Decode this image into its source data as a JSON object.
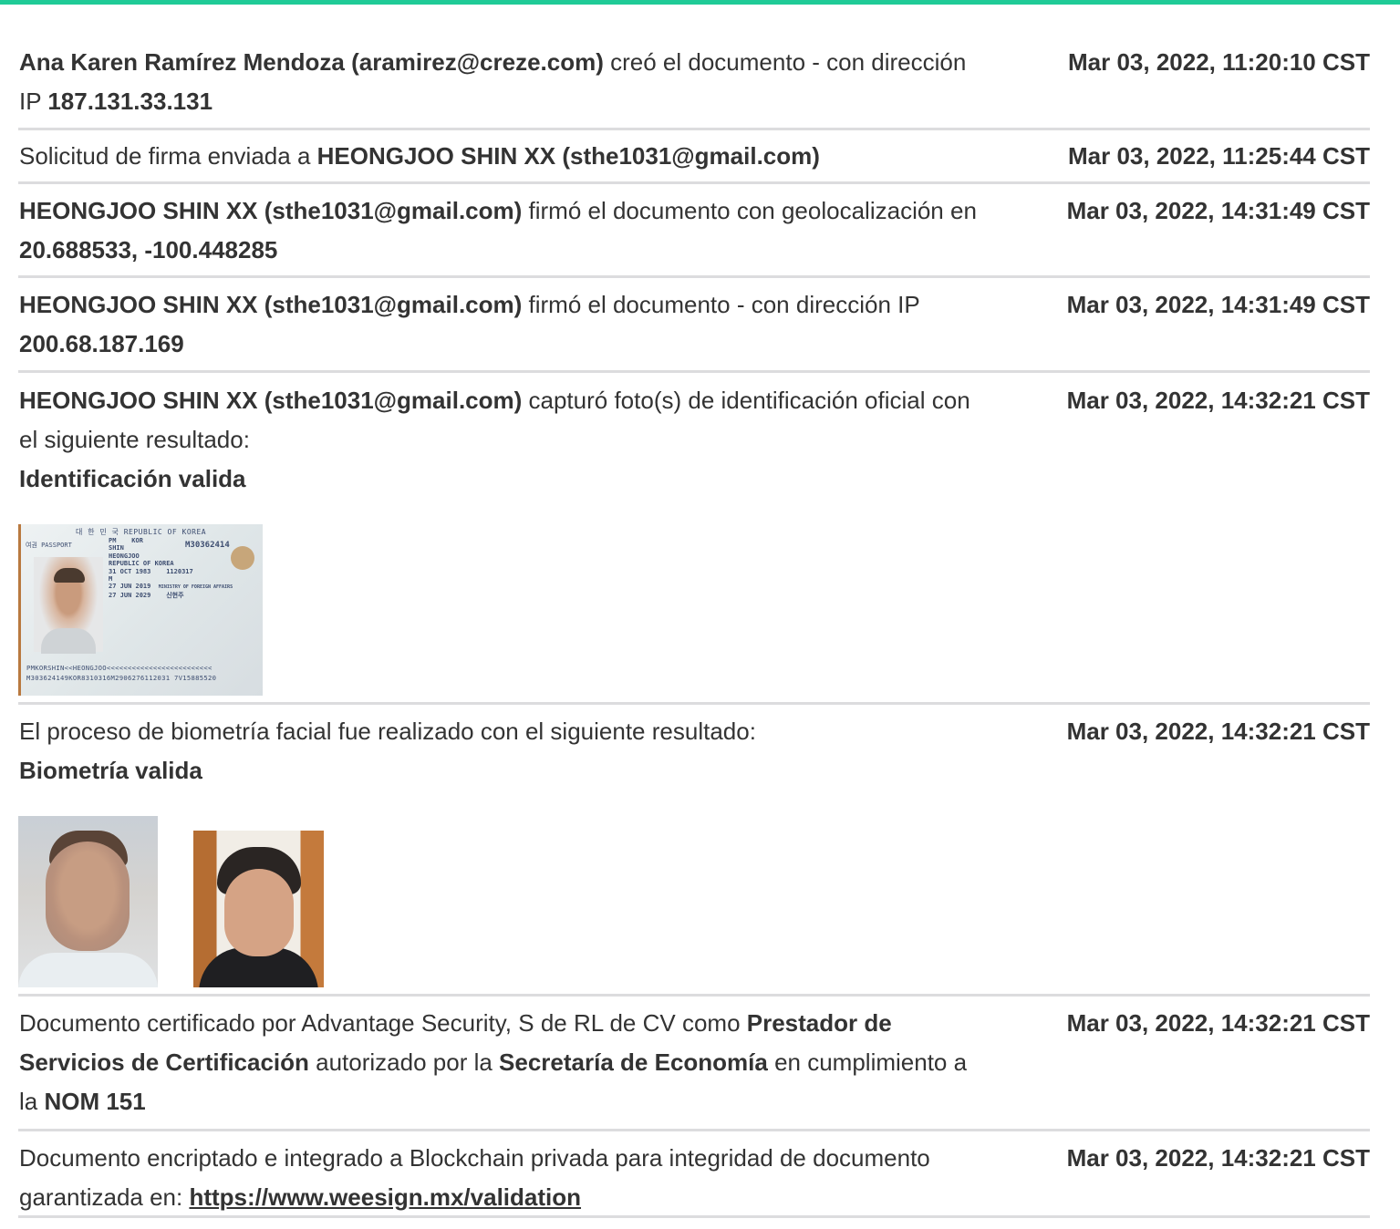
{
  "entries": [
    {
      "desc_bold_1": "Ana Karen Ramírez Mendoza (aramirez@creze.com)",
      "desc_text_1": " creó el documento - con dirección IP ",
      "desc_bold_2": "187.131.33.131",
      "timestamp": "Mar 03, 2022, 11:20:10 CST"
    },
    {
      "desc_text_1": "Solicitud de firma enviada a ",
      "desc_bold_1": "HEONGJOO SHIN XX (sthe1031@gmail.com)",
      "timestamp": "Mar 03, 2022, 11:25:44 CST"
    },
    {
      "desc_bold_1": "HEONGJOO SHIN XX (sthe1031@gmail.com)",
      "desc_text_1": " firmó el documento con geolocalización en ",
      "desc_bold_2": "20.688533, -100.448285",
      "timestamp": "Mar 03, 2022, 14:31:49 CST"
    },
    {
      "desc_bold_1": "HEONGJOO SHIN XX (sthe1031@gmail.com)",
      "desc_text_1": " firmó el documento - con dirección IP ",
      "desc_bold_2": "200.68.187.169",
      "timestamp": "Mar 03, 2022, 14:31:49 CST"
    },
    {
      "desc_bold_1": "HEONGJOO SHIN XX (sthe1031@gmail.com)",
      "desc_text_1": " capturó foto(s) de identificación oficial con el siguiente resultado:",
      "result": "Identificación valida",
      "timestamp": "Mar 03, 2022, 14:32:21 CST",
      "passport": {
        "header": "대 한 민 국   REPUBLIC OF KOREA",
        "doc_label": "여권 PASSPORT",
        "type": "PM",
        "country": "KOR",
        "number": "M30362414",
        "surname": "SHIN",
        "given_names": "HEONGJOO",
        "nationality": "REPUBLIC OF KOREA",
        "date_of_birth": "31 OCT 1983",
        "personal_no": "1120317",
        "sex": "M",
        "date_of_issue": "27 JUN 2019",
        "date_of_expiry": "27 JUN 2029",
        "authority": "MINISTRY OF FOREIGN AFFAIRS",
        "korean_name": "신현주",
        "mrz_line_1": "PMKORSHIN<<HEONGJOO<<<<<<<<<<<<<<<<<<<<<<<<<",
        "mrz_line_2": "M303624149KOR8310316M2906276112031 7V15885520"
      }
    },
    {
      "desc_text_1": "El proceso de biometría facial fue realizado con el siguiente resultado:",
      "result": "Biometría valida",
      "timestamp": "Mar 03, 2022, 14:32:21 CST"
    },
    {
      "desc_text_1": "Documento certificado por Advantage Security, S de RL de CV como ",
      "desc_bold_1": "Prestador de Servicios de Certificación",
      "desc_text_2": " autorizado por la ",
      "desc_bold_2": "Secretaría de Economía",
      "desc_text_3": " en cumplimiento a la ",
      "desc_bold_3": "NOM 151",
      "timestamp": "Mar 03, 2022, 14:32:21 CST"
    },
    {
      "desc_text_1": "Documento encriptado e integrado a Blockchain privada para integridad de documento garantizada en: ",
      "link": "https://www.weesign.mx/validation",
      "timestamp": "Mar 03, 2022, 14:32:21 CST"
    }
  ],
  "colors": {
    "accent_bar": "#1fcb97",
    "divider": "#dcdcde",
    "text": "#333333"
  }
}
